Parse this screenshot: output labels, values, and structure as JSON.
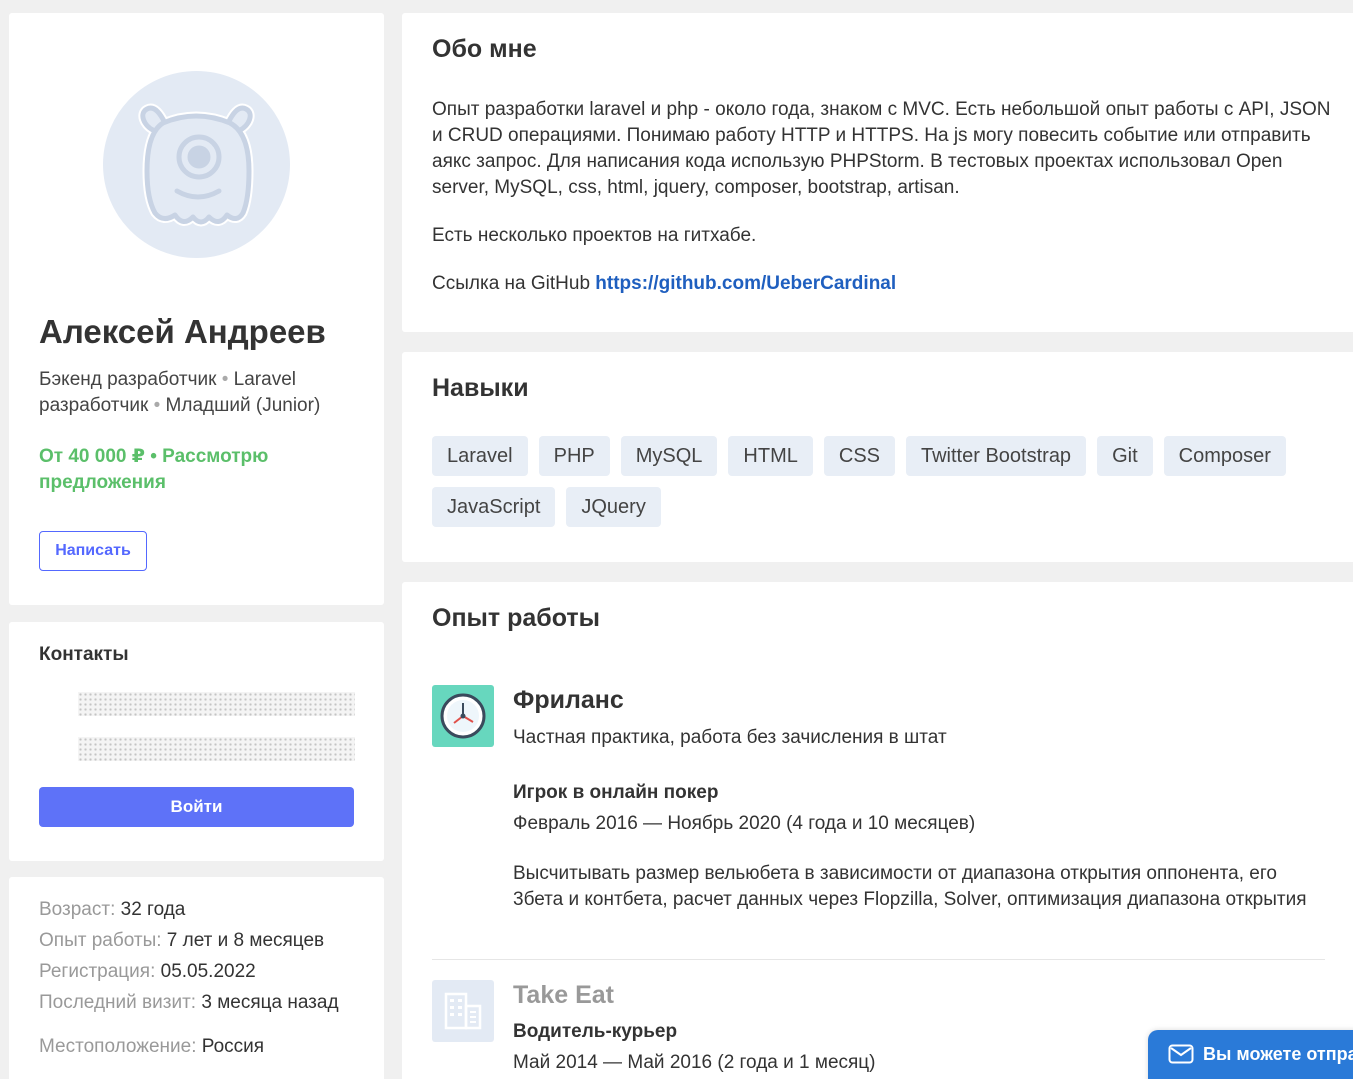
{
  "profile": {
    "name": "Алексей Андреев",
    "position_1": "Бэкенд разработчик",
    "separator": "•",
    "position_2": "Laravel разработчик",
    "position_3": "Младший (Junior)",
    "salary": "От 40 000 ₽ • Рассмотрю предложения",
    "write_button": "Написать",
    "avatar_icon": "monster-avatar-icon"
  },
  "contacts": {
    "title": "Контакты",
    "login_button": "Войти"
  },
  "info": {
    "age_key": "Возраст:",
    "age_value": "32 года",
    "experience_key": "Опыт работы:",
    "experience_value": "7 лет и 8 месяцев",
    "registration_key": "Регистрация:",
    "registration_value": "05.05.2022",
    "last_visit_key": "Последний визит:",
    "last_visit_value": "3 месяца назад",
    "location_key": "Местоположение:",
    "location_value": "Россия"
  },
  "about": {
    "title": "Обо мне",
    "paragraph_1": "Опыт разработки laravel и php - около года, знаком с MVC. Есть небольшой опыт работы с API, JSON и CRUD операциями. Понимаю работу HTTP и HTTPS. На js могу повесить событие или отправить аякс запрос. Для написания кода использую PHPStorm. В тестовых проектах использовал Open server, MySQL, css, html, jquery, composer, bootstrap, artisan.",
    "paragraph_2": "Есть несколько проектов на гитхабе.",
    "github_label": "Ссылка на GitHub",
    "github_link": "https://github.com/UeberCardinal"
  },
  "skills": {
    "title": "Навыки",
    "items": [
      "Laravel",
      "PHP",
      "MySQL",
      "HTML",
      "CSS",
      "Twitter Bootstrap",
      "Git",
      "Composer",
      "JavaScript",
      "JQuery"
    ]
  },
  "experience": {
    "title": "Опыт работы",
    "jobs": [
      {
        "company": "Фриланс",
        "subtitle": "Частная практика, работа без зачисления в штат",
        "role": "Игрок в онлайн покер",
        "period": "Февраль 2016 — Ноябрь 2020 (4 года и 10 месяцев)",
        "description": "Высчитывать размер вельюбета в зависимости от диапазона открытия оппонента, его 3бета и контбета, расчет данных через Flopzilla, Solver, оптимизация диапазона открытия",
        "icon": "clock-icon"
      },
      {
        "company": "Take Eat",
        "role": "Водитель-курьер",
        "period": "Май 2014 — Май 2016 (2 года и 1 месяц)",
        "icon": "building-icon"
      }
    ]
  },
  "chat_widget": {
    "text": "Вы можете отправить сообщение",
    "icon": "mail-icon"
  }
}
